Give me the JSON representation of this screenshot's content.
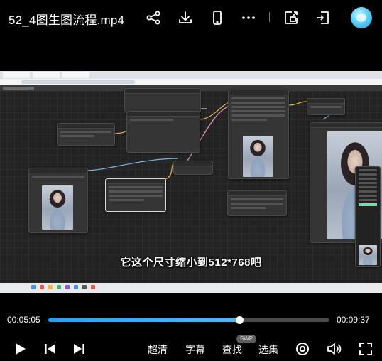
{
  "header": {
    "title": "52_4图生图流程.mp4",
    "icons": [
      "share-icon",
      "download-icon",
      "phone-cast-icon",
      "more-icon",
      "picture-in-picture-icon",
      "exit-fullscreen-icon",
      "avatar-icon"
    ]
  },
  "video": {
    "subtitle": "它这个尺寸缩小到512*768吧"
  },
  "progress": {
    "current_time": "00:05:05",
    "total_time": "00:09:37",
    "fraction": 0.68
  },
  "controls": {
    "quality_label": "超清",
    "subtitles_label": "字幕",
    "search_label": "查找",
    "search_badge": "SWP",
    "episodes_label": "选集",
    "icons": [
      "play-icon",
      "previous-icon",
      "next-icon",
      "danmaku-icon",
      "volume-icon",
      "fullscreen-icon"
    ]
  },
  "colors": {
    "accent": "#1aa3ff",
    "background": "#000000"
  }
}
